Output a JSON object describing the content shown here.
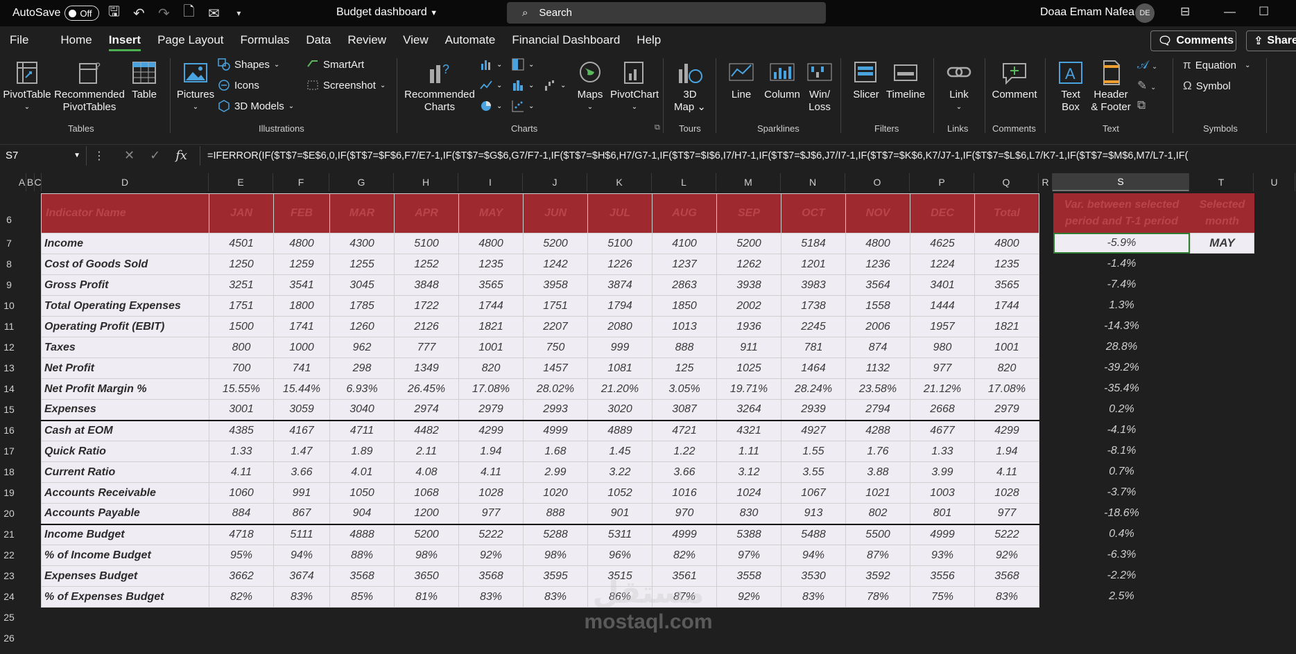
{
  "titlebar": {
    "autosave": "AutoSave",
    "autosave_state": "Off",
    "doc_title": "Budget dashboard",
    "search_placeholder": "Search",
    "user_name": "Doaa Emam Nafea",
    "user_initials": "DE"
  },
  "menu": {
    "items": [
      "File",
      "Home",
      "Insert",
      "Page Layout",
      "Formulas",
      "Data",
      "Review",
      "View",
      "Automate",
      "Financial Dashboard",
      "Help"
    ],
    "active": "Insert",
    "comments_btn": "Comments",
    "share_btn": "Share"
  },
  "ribbon": {
    "tables": {
      "label": "Tables",
      "pivottable": "PivotTable",
      "recommended_pivot_1": "Recommended",
      "recommended_pivot_2": "PivotTables",
      "table": "Table"
    },
    "illustrations": {
      "label": "Illustrations",
      "pictures": "Pictures",
      "shapes": "Shapes",
      "icons": "Icons",
      "models": "3D Models",
      "smartart": "SmartArt",
      "screenshot": "Screenshot"
    },
    "charts": {
      "label": "Charts",
      "recommended_1": "Recommended",
      "recommended_2": "Charts",
      "maps": "Maps",
      "pivotchart": "PivotChart"
    },
    "tours": {
      "label": "Tours",
      "map_1": "3D",
      "map_2": "Map"
    },
    "sparklines": {
      "label": "Sparklines",
      "line": "Line",
      "column": "Column",
      "winloss_1": "Win/",
      "winloss_2": "Loss"
    },
    "filters": {
      "label": "Filters",
      "slicer": "Slicer",
      "timeline": "Timeline"
    },
    "links": {
      "label": "Links",
      "link": "Link"
    },
    "comments": {
      "label": "Comments",
      "comment": "Comment"
    },
    "text": {
      "label": "Text",
      "textbox_1": "Text",
      "textbox_2": "Box",
      "header_1": "Header",
      "header_2": "& Footer"
    },
    "symbols": {
      "label": "Symbols",
      "equation": "Equation",
      "symbol": "Symbol"
    }
  },
  "formula_bar": {
    "cell_ref": "S7",
    "fx": "fx",
    "formula": "=IFERROR(IF($T$7=$E$6,0,IF($T$7=$F$6,F7/E7-1,IF($T$7=$G$6,G7/F7-1,IF($T$7=$H$6,H7/G7-1,IF($T$7=$I$6,I7/H7-1,IF($T$7=$J$6,J7/I7-1,IF($T$7=$K$6,K7/J7-1,IF($T$7=$L$6,L7/K7-1,IF($T$7=$M$6,M7/L7-1,IF("
  },
  "columns": [
    "A",
    "B",
    "C",
    "D",
    "E",
    "F",
    "G",
    "H",
    "I",
    "J",
    "K",
    "L",
    "M",
    "N",
    "O",
    "P",
    "Q",
    "R",
    "S",
    "T",
    "U"
  ],
  "rows": [
    "6",
    "7",
    "8",
    "9",
    "10",
    "11",
    "12",
    "13",
    "14",
    "15",
    "16",
    "17",
    "18",
    "19",
    "20",
    "21",
    "22",
    "23",
    "24",
    "25",
    "26"
  ],
  "table": {
    "headers": [
      "Indicator Name",
      "JAN",
      "FEB",
      "MAR",
      "APR",
      "MAY",
      "JUN",
      "JUL",
      "AUG",
      "SEP",
      "OCT",
      "NOV",
      "DEC",
      "Total"
    ],
    "data": [
      [
        "Income",
        "4501",
        "4800",
        "4300",
        "5100",
        "4800",
        "5200",
        "5100",
        "4100",
        "5200",
        "5184",
        "4800",
        "4625",
        "4800"
      ],
      [
        "Cost of Goods Sold",
        "1250",
        "1259",
        "1255",
        "1252",
        "1235",
        "1242",
        "1226",
        "1237",
        "1262",
        "1201",
        "1236",
        "1224",
        "1235"
      ],
      [
        "Gross Profit",
        "3251",
        "3541",
        "3045",
        "3848",
        "3565",
        "3958",
        "3874",
        "2863",
        "3938",
        "3983",
        "3564",
        "3401",
        "3565"
      ],
      [
        "Total Operating Expenses",
        "1751",
        "1800",
        "1785",
        "1722",
        "1744",
        "1751",
        "1794",
        "1850",
        "2002",
        "1738",
        "1558",
        "1444",
        "1744"
      ],
      [
        "Operating Profit (EBIT)",
        "1500",
        "1741",
        "1260",
        "2126",
        "1821",
        "2207",
        "2080",
        "1013",
        "1936",
        "2245",
        "2006",
        "1957",
        "1821"
      ],
      [
        "Taxes",
        "800",
        "1000",
        "962",
        "777",
        "1001",
        "750",
        "999",
        "888",
        "911",
        "781",
        "874",
        "980",
        "1001"
      ],
      [
        "Net Profit",
        "700",
        "741",
        "298",
        "1349",
        "820",
        "1457",
        "1081",
        "125",
        "1025",
        "1464",
        "1132",
        "977",
        "820"
      ],
      [
        "Net Profit Margin %",
        "15.55%",
        "15.44%",
        "6.93%",
        "26.45%",
        "17.08%",
        "28.02%",
        "21.20%",
        "3.05%",
        "19.71%",
        "28.24%",
        "23.58%",
        "21.12%",
        "17.08%"
      ],
      [
        "Expenses",
        "3001",
        "3059",
        "3040",
        "2974",
        "2979",
        "2993",
        "3020",
        "3087",
        "3264",
        "2939",
        "2794",
        "2668",
        "2979"
      ],
      [
        "Cash at EOM",
        "4385",
        "4167",
        "4711",
        "4482",
        "4299",
        "4999",
        "4889",
        "4721",
        "4321",
        "4927",
        "4288",
        "4677",
        "4299"
      ],
      [
        "Quick Ratio",
        "1.33",
        "1.47",
        "1.89",
        "2.11",
        "1.94",
        "1.68",
        "1.45",
        "1.22",
        "1.11",
        "1.55",
        "1.76",
        "1.33",
        "1.94"
      ],
      [
        "Current Ratio",
        "4.11",
        "3.66",
        "4.01",
        "4.08",
        "4.11",
        "2.99",
        "3.22",
        "3.66",
        "3.12",
        "3.55",
        "3.88",
        "3.99",
        "4.11"
      ],
      [
        "Accounts Receivable",
        "1060",
        "991",
        "1050",
        "1068",
        "1028",
        "1020",
        "1052",
        "1016",
        "1024",
        "1067",
        "1021",
        "1003",
        "1028"
      ],
      [
        "Accounts Payable",
        "884",
        "867",
        "904",
        "1200",
        "977",
        "888",
        "901",
        "970",
        "830",
        "913",
        "802",
        "801",
        "977"
      ],
      [
        "Income Budget",
        "4718",
        "5111",
        "4888",
        "5200",
        "5222",
        "5288",
        "5311",
        "4999",
        "5388",
        "5488",
        "5500",
        "4999",
        "5222"
      ],
      [
        "% of Income Budget",
        "95%",
        "94%",
        "88%",
        "98%",
        "92%",
        "98%",
        "96%",
        "82%",
        "97%",
        "94%",
        "87%",
        "93%",
        "92%"
      ],
      [
        "Expenses Budget",
        "3662",
        "3674",
        "3568",
        "3650",
        "3568",
        "3595",
        "3515",
        "3561",
        "3558",
        "3530",
        "3592",
        "3556",
        "3568"
      ],
      [
        "% of Expenses Budget",
        "82%",
        "83%",
        "85%",
        "81%",
        "83%",
        "83%",
        "86%",
        "87%",
        "92%",
        "83%",
        "78%",
        "75%",
        "83%"
      ]
    ]
  },
  "side": {
    "var_header": "Var. between selected period and T-1 period",
    "sel_header": "Selected month",
    "selected_month": "MAY",
    "variance": [
      "-5.9%",
      "-1.4%",
      "-7.4%",
      "1.3%",
      "-14.3%",
      "28.8%",
      "-39.2%",
      "-35.4%",
      "0.2%",
      "-4.1%",
      "-8.1%",
      "0.7%",
      "-3.7%",
      "-18.6%",
      "0.4%",
      "-6.3%",
      "-2.2%",
      "2.5%"
    ]
  },
  "watermark": {
    "line1": "مستقل",
    "line2": "mostaql.com"
  }
}
